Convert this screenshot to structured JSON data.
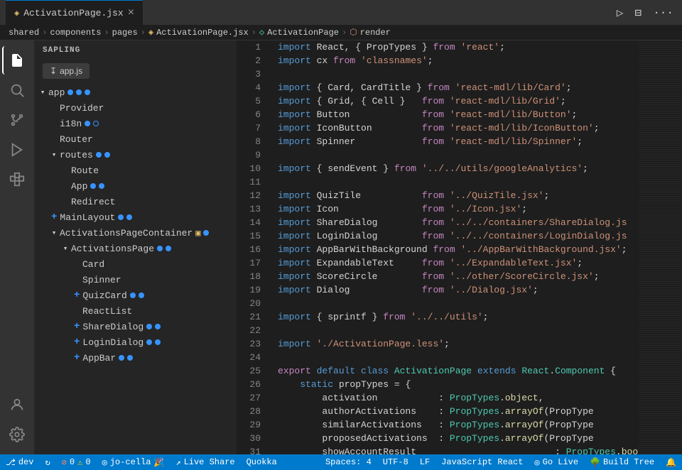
{
  "titlebar": {
    "tab_icon": "◈",
    "tab_label": "ActivationPage.jsx",
    "tab_close": "×",
    "action_run": "▷",
    "action_split": "⊟",
    "action_more": "···"
  },
  "breadcrumb": {
    "parts": [
      "shared",
      ">",
      "components",
      ">",
      "pages",
      ">",
      "ActivationPage.jsx",
      ">",
      "ActivationPage",
      ">",
      "render"
    ]
  },
  "activity": {
    "icons": [
      "files",
      "search",
      "source-control",
      "run",
      "extensions",
      "sapling",
      "account",
      "settings"
    ]
  },
  "sidebar": {
    "title": "SAPLING",
    "file_btn_icon": "↧",
    "file_btn_label": "app.js",
    "tree": [
      {
        "level": 0,
        "label": "app",
        "arrow": "▾",
        "expanded": true,
        "dots": 3
      },
      {
        "level": 1,
        "label": "Provider",
        "arrow": "",
        "expanded": false,
        "dots": 0
      },
      {
        "level": 1,
        "label": "i18n",
        "arrow": "",
        "expanded": false,
        "dots": 2,
        "type": "i18n"
      },
      {
        "level": 1,
        "label": "Router",
        "arrow": "",
        "expanded": false,
        "dots": 0
      },
      {
        "level": 1,
        "label": "routes",
        "arrow": "▾",
        "expanded": true,
        "dots": 2
      },
      {
        "level": 2,
        "label": "Route",
        "arrow": "",
        "expanded": false,
        "dots": 0
      },
      {
        "level": 2,
        "label": "App",
        "arrow": "",
        "expanded": false,
        "dots": 2
      },
      {
        "level": 2,
        "label": "Redirect",
        "arrow": "",
        "expanded": false,
        "dots": 0
      },
      {
        "level": 1,
        "label": "MainLayout",
        "arrow": "",
        "expanded": false,
        "dots": 2,
        "plus": true
      },
      {
        "level": 1,
        "label": "ActivationsPageContainer",
        "arrow": "▾",
        "expanded": true,
        "dots": 1,
        "container": true
      },
      {
        "level": 2,
        "label": "ActivationsPage",
        "arrow": "▾",
        "expanded": true,
        "dots": 2
      },
      {
        "level": 3,
        "label": "Card",
        "arrow": "",
        "expanded": false,
        "dots": 0
      },
      {
        "level": 3,
        "label": "Spinner",
        "arrow": "",
        "expanded": false,
        "dots": 0
      },
      {
        "level": 3,
        "label": "QuizCard",
        "arrow": "",
        "expanded": false,
        "dots": 2,
        "plus": true
      },
      {
        "level": 3,
        "label": "ReactList",
        "arrow": "",
        "expanded": false,
        "dots": 0
      },
      {
        "level": 3,
        "label": "ShareDialog",
        "arrow": "",
        "expanded": false,
        "dots": 2,
        "plus": true
      },
      {
        "level": 3,
        "label": "LoginDialog",
        "arrow": "",
        "expanded": false,
        "dots": 2,
        "plus": true
      },
      {
        "level": 3,
        "label": "AppBar",
        "arrow": "",
        "expanded": false,
        "dots": 2,
        "plus": true
      }
    ]
  },
  "code": {
    "lines": [
      {
        "num": 1,
        "tokens": [
          {
            "t": "import-kw",
            "v": "import"
          },
          {
            "t": "punct",
            "v": " React, { PropTypes } "
          },
          {
            "t": "from-kw",
            "v": "from"
          },
          {
            "t": "str",
            "v": " 'react'"
          },
          {
            "t": "punct",
            "v": ";"
          }
        ]
      },
      {
        "num": 2,
        "tokens": [
          {
            "t": "import-kw",
            "v": "import"
          },
          {
            "t": "punct",
            "v": " cx "
          },
          {
            "t": "from-kw",
            "v": "from"
          },
          {
            "t": "str",
            "v": " 'classnames'"
          },
          {
            "t": "punct",
            "v": ";"
          }
        ]
      },
      {
        "num": 3,
        "tokens": []
      },
      {
        "num": 4,
        "tokens": [
          {
            "t": "import-kw",
            "v": "import"
          },
          {
            "t": "punct",
            "v": " { Card, CardTitle } "
          },
          {
            "t": "from-kw",
            "v": "from"
          },
          {
            "t": "str",
            "v": " 'react-mdl/lib/Card'"
          },
          {
            "t": "punct",
            "v": ";"
          }
        ]
      },
      {
        "num": 5,
        "tokens": [
          {
            "t": "import-kw",
            "v": "import"
          },
          {
            "t": "punct",
            "v": " { Grid, { Cell } "
          },
          {
            "t": "from-kw",
            "v": "  from"
          },
          {
            "t": "str",
            "v": " 'react-mdl/lib/Grid'"
          },
          {
            "t": "punct",
            "v": ";"
          }
        ]
      },
      {
        "num": 6,
        "tokens": [
          {
            "t": "import-kw",
            "v": "import"
          },
          {
            "t": "punct",
            "v": " Button           "
          },
          {
            "t": "from-kw",
            "v": "  from"
          },
          {
            "t": "str",
            "v": " 'react-mdl/lib/Button'"
          },
          {
            "t": "punct",
            "v": ";"
          }
        ]
      },
      {
        "num": 7,
        "tokens": [
          {
            "t": "import-kw",
            "v": "import"
          },
          {
            "t": "punct",
            "v": " IconButton       "
          },
          {
            "t": "from-kw",
            "v": "  from"
          },
          {
            "t": "str",
            "v": " 'react-mdl/lib/IconButton'"
          },
          {
            "t": "punct",
            "v": ";"
          }
        ]
      },
      {
        "num": 8,
        "tokens": [
          {
            "t": "import-kw",
            "v": "import"
          },
          {
            "t": "punct",
            "v": " Spinner          "
          },
          {
            "t": "from-kw",
            "v": "  from"
          },
          {
            "t": "str",
            "v": " 'react-mdl/lib/Spinner'"
          },
          {
            "t": "punct",
            "v": ";"
          }
        ]
      },
      {
        "num": 9,
        "tokens": []
      },
      {
        "num": 10,
        "tokens": [
          {
            "t": "import-kw",
            "v": "import"
          },
          {
            "t": "punct",
            "v": " { sendEvent } "
          },
          {
            "t": "from-kw",
            "v": "from"
          },
          {
            "t": "str",
            "v": " '../../utils/googleAnalytics'"
          },
          {
            "t": "punct",
            "v": ";"
          }
        ]
      },
      {
        "num": 11,
        "tokens": []
      },
      {
        "num": 12,
        "tokens": [
          {
            "t": "import-kw",
            "v": "import"
          },
          {
            "t": "punct",
            "v": " QuizTile         "
          },
          {
            "t": "from-kw",
            "v": "  from"
          },
          {
            "t": "str",
            "v": " '../QuizTile.jsx'"
          },
          {
            "t": "punct",
            "v": ";"
          }
        ]
      },
      {
        "num": 13,
        "tokens": [
          {
            "t": "import-kw",
            "v": "import"
          },
          {
            "t": "punct",
            "v": " Icon             "
          },
          {
            "t": "from-kw",
            "v": "  from"
          },
          {
            "t": "str",
            "v": " '../Icon.jsx'"
          },
          {
            "t": "punct",
            "v": ";"
          }
        ]
      },
      {
        "num": 14,
        "tokens": [
          {
            "t": "import-kw",
            "v": "import"
          },
          {
            "t": "punct",
            "v": " ShareDialog      "
          },
          {
            "t": "from-kw",
            "v": "  from"
          },
          {
            "t": "str",
            "v": " '../../containers/ShareDialog.js"
          },
          {
            "t": "punct",
            "v": ""
          }
        ]
      },
      {
        "num": 15,
        "tokens": [
          {
            "t": "import-kw",
            "v": "import"
          },
          {
            "t": "punct",
            "v": " LoginDialog      "
          },
          {
            "t": "from-kw",
            "v": "  from"
          },
          {
            "t": "str",
            "v": " '../../containers/LoginDialog.js"
          },
          {
            "t": "punct",
            "v": ""
          }
        ]
      },
      {
        "num": 16,
        "tokens": [
          {
            "t": "import-kw",
            "v": "import"
          },
          {
            "t": "punct",
            "v": " AppBarWithBackground "
          },
          {
            "t": "from-kw",
            "v": "from"
          },
          {
            "t": "str",
            "v": " '../AppBarWithBackground.jsx'"
          },
          {
            "t": "punct",
            "v": ";"
          }
        ]
      },
      {
        "num": 17,
        "tokens": [
          {
            "t": "import-kw",
            "v": "import"
          },
          {
            "t": "punct",
            "v": " ExpandableText   "
          },
          {
            "t": "from-kw",
            "v": "  from"
          },
          {
            "t": "str",
            "v": " '../ExpandableText.jsx'"
          },
          {
            "t": "punct",
            "v": ";"
          }
        ]
      },
      {
        "num": 18,
        "tokens": [
          {
            "t": "import-kw",
            "v": "import"
          },
          {
            "t": "punct",
            "v": " ScoreCircle      "
          },
          {
            "t": "from-kw",
            "v": "  from"
          },
          {
            "t": "str",
            "v": " '../other/ScoreCircle.jsx'"
          },
          {
            "t": "punct",
            "v": ";"
          }
        ]
      },
      {
        "num": 19,
        "tokens": [
          {
            "t": "import-kw",
            "v": "import"
          },
          {
            "t": "punct",
            "v": " Dialog           "
          },
          {
            "t": "from-kw",
            "v": "  from"
          },
          {
            "t": "str",
            "v": " '../Dialog.jsx'"
          },
          {
            "t": "punct",
            "v": ";"
          }
        ]
      },
      {
        "num": 20,
        "tokens": []
      },
      {
        "num": 21,
        "tokens": [
          {
            "t": "import-kw",
            "v": "import"
          },
          {
            "t": "punct",
            "v": " { sprintf } "
          },
          {
            "t": "from-kw",
            "v": "from"
          },
          {
            "t": "str",
            "v": " '../../utils'"
          },
          {
            "t": "punct",
            "v": ";"
          }
        ]
      },
      {
        "num": 22,
        "tokens": []
      },
      {
        "num": 23,
        "tokens": [
          {
            "t": "import-kw",
            "v": "import"
          },
          {
            "t": "str",
            "v": " './ActivationPage.less'"
          },
          {
            "t": "punct",
            "v": ";"
          }
        ]
      },
      {
        "num": 24,
        "tokens": []
      },
      {
        "num": 25,
        "tokens": [
          {
            "t": "kw2",
            "v": "export"
          },
          {
            "t": "punct",
            "v": " "
          },
          {
            "t": "kw",
            "v": "default"
          },
          {
            "t": "punct",
            "v": " "
          },
          {
            "t": "kw",
            "v": "class"
          },
          {
            "t": "punct",
            "v": " "
          },
          {
            "t": "cls",
            "v": "ActivationPage"
          },
          {
            "t": "punct",
            "v": " "
          },
          {
            "t": "kw",
            "v": "extends"
          },
          {
            "t": "punct",
            "v": " "
          },
          {
            "t": "cls",
            "v": "React"
          },
          {
            "t": "punct",
            "v": "."
          },
          {
            "t": "cls",
            "v": "Component"
          },
          {
            "t": "punct",
            "v": " {"
          }
        ]
      },
      {
        "num": 26,
        "tokens": [
          {
            "t": "punct",
            "v": "    "
          },
          {
            "t": "kw",
            "v": "static"
          },
          {
            "t": "punct",
            "v": " propTypes = {"
          }
        ]
      },
      {
        "num": 27,
        "tokens": [
          {
            "t": "punct",
            "v": "        activation           : "
          },
          {
            "t": "cls",
            "v": "PropTypes"
          },
          {
            "t": "punct",
            "v": "."
          },
          {
            "t": "fn",
            "v": "object"
          },
          {
            "t": "punct",
            "v": ","
          }
        ]
      },
      {
        "num": 28,
        "tokens": [
          {
            "t": "punct",
            "v": "        authorActivations    : "
          },
          {
            "t": "cls",
            "v": "PropTypes"
          },
          {
            "t": "punct",
            "v": "."
          },
          {
            "t": "fn",
            "v": "arrayOf"
          },
          {
            "t": "punct",
            "v": "(PropType"
          }
        ]
      },
      {
        "num": 29,
        "tokens": [
          {
            "t": "punct",
            "v": "        similarActivations   : "
          },
          {
            "t": "cls",
            "v": "PropTypes"
          },
          {
            "t": "punct",
            "v": "."
          },
          {
            "t": "fn",
            "v": "arrayOf"
          },
          {
            "t": "punct",
            "v": "(PropType"
          }
        ]
      },
      {
        "num": 30,
        "tokens": [
          {
            "t": "punct",
            "v": "        proposedActivations  : "
          },
          {
            "t": "cls",
            "v": "PropTypes"
          },
          {
            "t": "punct",
            "v": "."
          },
          {
            "t": "fn",
            "v": "arrayOf"
          },
          {
            "t": "punct",
            "v": "(PropType"
          }
        ]
      },
      {
        "num": 31,
        "tokens": [
          {
            "t": "punct",
            "v": "        showAccountResult"
          },
          {
            "t": "punct",
            "v": "                         : "
          },
          {
            "t": "cls",
            "v": "PropTypes"
          },
          {
            "t": "punct",
            "v": "."
          },
          {
            "t": "fn",
            "v": "bool"
          },
          {
            "t": "punct",
            "v": ","
          }
        ]
      }
    ]
  },
  "statusbar": {
    "branch_icon": "⎇",
    "branch": "dev",
    "sync_icon": "↻",
    "error_icon": "⊘",
    "errors": "0",
    "warning_icon": "⚠",
    "warnings": "0",
    "user_icon": "◎",
    "user": "jo-cella",
    "user_emoji": "🎉",
    "liveshare_icon": "↗",
    "liveshare": "Live Share",
    "extension": "Quokka",
    "spaces_label": "Spaces: 4",
    "encoding": "UTF-8",
    "eol": "LF",
    "language": "JavaScript React",
    "go_live_icon": "◎",
    "go_live": "Go Live",
    "build_icon": "🌳",
    "build_tree": "Build Tree",
    "notif_icon": "🔔",
    "more_icon": "≡"
  }
}
